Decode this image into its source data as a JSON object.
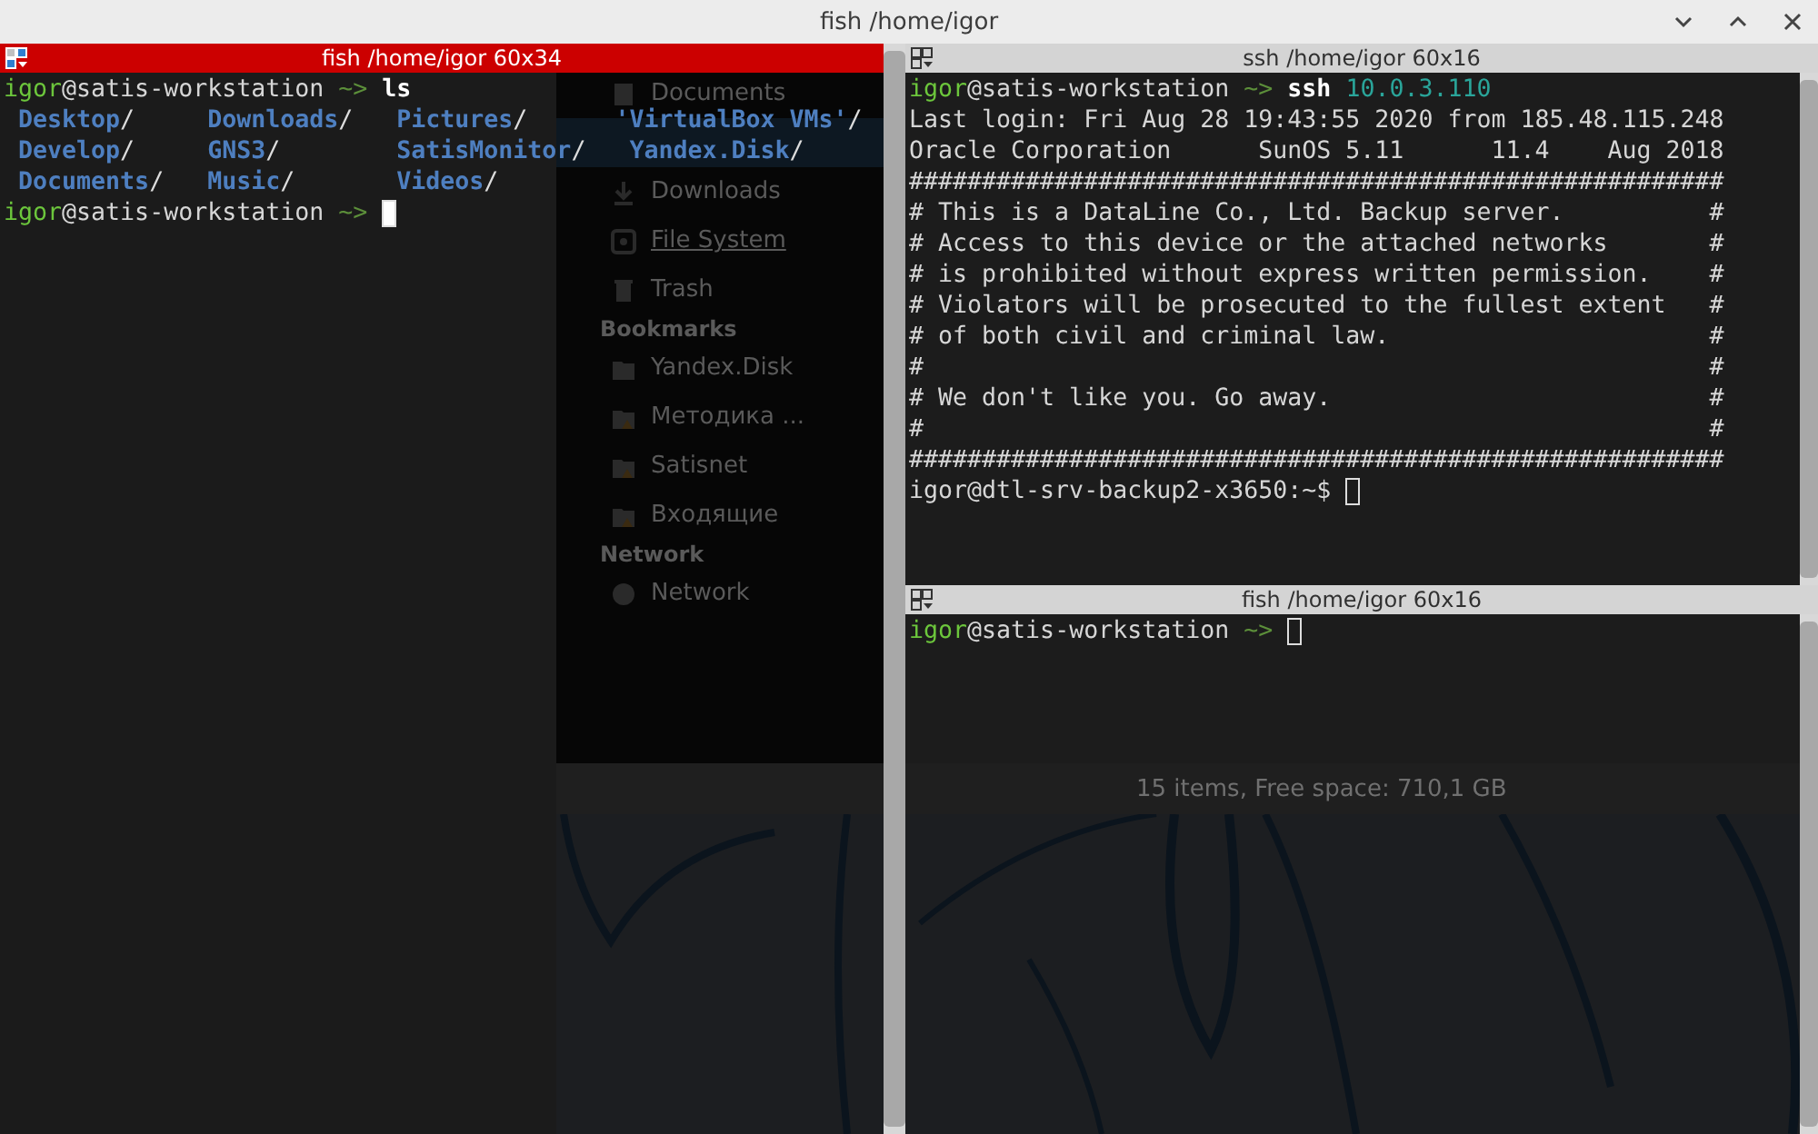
{
  "window": {
    "title": "fish /home/igor"
  },
  "background_window": {
    "sidebar": [
      {
        "kind": "document",
        "label": "Documents"
      },
      {
        "kind": "gap",
        "selected": true
      },
      {
        "kind": "download",
        "label": "Downloads"
      },
      {
        "kind": "drive",
        "label": "File System"
      },
      {
        "kind": "trash",
        "label": "Trash"
      },
      {
        "kind": "header",
        "label": "Bookmarks"
      },
      {
        "kind": "folder",
        "label": "Yandex.Disk"
      },
      {
        "kind": "folder-warning",
        "label": "Методика ..."
      },
      {
        "kind": "folder-warning",
        "label": "Satisnet"
      },
      {
        "kind": "folder-warning",
        "label": "Входящие"
      },
      {
        "kind": "header",
        "label": "Network"
      },
      {
        "kind": "globe",
        "label": "Network"
      }
    ],
    "status": "15 items, Free space: 710,1 GB"
  },
  "panes": [
    {
      "title": "fish /home/igor 60x34",
      "focused": true,
      "lines": [
        {
          "kind": "prompt",
          "user": "igor",
          "host": "@satis-workstation",
          "arrow": "~>",
          "command": "ls"
        },
        {
          "kind": "listing",
          "entries": [
            {
              "name": "Desktop",
              "suffix": "/"
            },
            {
              "name": "Downloads",
              "suffix": "/"
            },
            {
              "name": "Pictures",
              "suffix": "/"
            },
            {
              "name": "'VirtualBox VMs'",
              "suffix": "/"
            }
          ]
        },
        {
          "kind": "listing",
          "entries": [
            {
              "name": "Develop",
              "suffix": "/"
            },
            {
              "name": "GNS3",
              "suffix": "/"
            },
            {
              "name": "SatisMonitor",
              "suffix": "/"
            },
            {
              "name": " Yandex.Disk",
              "suffix": "/"
            }
          ]
        },
        {
          "kind": "listing",
          "entries": [
            {
              "name": "Documents",
              "suffix": "/"
            },
            {
              "name": "Music",
              "suffix": "/"
            },
            {
              "name": "Videos",
              "suffix": "/"
            }
          ]
        },
        {
          "kind": "prompt",
          "user": "igor",
          "host": "@satis-workstation",
          "arrow": "~>",
          "cursor": true
        }
      ]
    },
    {
      "title": "ssh /home/igor 60x16",
      "focused": false,
      "lines": [
        {
          "kind": "prompt",
          "user": "igor",
          "host": "@satis-workstation",
          "arrow": "~>",
          "command": "ssh",
          "argument": "10.0.3.110"
        },
        {
          "kind": "text",
          "text": "Last login: Fri Aug 28 19:43:55 2020 from 185.48.115.248"
        },
        {
          "kind": "text",
          "text": "Oracle Corporation      SunOS 5.11      11.4    Aug 2018"
        },
        {
          "kind": "text",
          "text": "########################################################"
        },
        {
          "kind": "text",
          "text": "# This is a DataLine Co., Ltd. Backup server.          #"
        },
        {
          "kind": "text",
          "text": "# Access to this device or the attached networks       #"
        },
        {
          "kind": "text",
          "text": "# is prohibited without express written permission.    #"
        },
        {
          "kind": "text",
          "text": "# Violators will be prosecuted to the fullest extent   #"
        },
        {
          "kind": "text",
          "text": "# of both civil and criminal law.                      #"
        },
        {
          "kind": "text",
          "text": "#                                                      #"
        },
        {
          "kind": "text",
          "text": "# We don't like you. Go away.                          #"
        },
        {
          "kind": "text",
          "text": "#                                                      #"
        },
        {
          "kind": "text",
          "text": "########################################################"
        },
        {
          "kind": "text",
          "text": "igor@dtl-srv-backup2-x3650:~$",
          "cursor": true
        }
      ]
    },
    {
      "title": "fish /home/igor 60x16",
      "focused": false,
      "lines": [
        {
          "kind": "prompt",
          "user": "igor",
          "host": "@satis-workstation",
          "arrow": "~>",
          "cursor": true
        }
      ]
    }
  ]
}
